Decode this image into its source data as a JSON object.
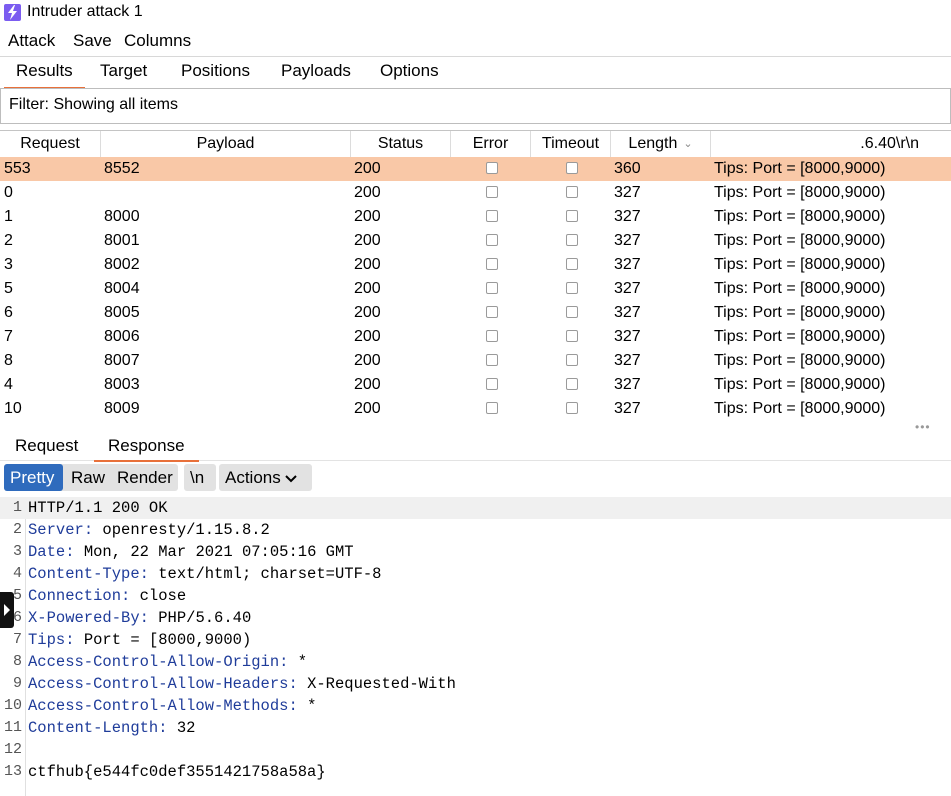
{
  "window": {
    "title": "Intruder attack 1"
  },
  "menu": [
    "Attack",
    "Save",
    "Columns"
  ],
  "top_tabs": [
    {
      "label": "Results",
      "active": true
    },
    {
      "label": "Target",
      "active": false
    },
    {
      "label": "Positions",
      "active": false
    },
    {
      "label": "Payloads",
      "active": false
    },
    {
      "label": "Options",
      "active": false
    }
  ],
  "filter": {
    "text": "Filter: Showing all items"
  },
  "table": {
    "headers": [
      "Request",
      "Payload",
      "Status",
      "Error",
      "Timeout",
      "Length",
      ".6.40\\r\\n"
    ],
    "rows": [
      {
        "request": "553",
        "payload": "8552",
        "status": "200",
        "length": "360",
        "extract": "Tips: Port = [8000,9000)",
        "selected": true
      },
      {
        "request": "0",
        "payload": "",
        "status": "200",
        "length": "327",
        "extract": "Tips: Port = [8000,9000)"
      },
      {
        "request": "1",
        "payload": "8000",
        "status": "200",
        "length": "327",
        "extract": "Tips: Port = [8000,9000)"
      },
      {
        "request": "2",
        "payload": "8001",
        "status": "200",
        "length": "327",
        "extract": "Tips: Port = [8000,9000)"
      },
      {
        "request": "3",
        "payload": "8002",
        "status": "200",
        "length": "327",
        "extract": "Tips: Port = [8000,9000)"
      },
      {
        "request": "5",
        "payload": "8004",
        "status": "200",
        "length": "327",
        "extract": "Tips: Port = [8000,9000)"
      },
      {
        "request": "6",
        "payload": "8005",
        "status": "200",
        "length": "327",
        "extract": "Tips: Port = [8000,9000)"
      },
      {
        "request": "7",
        "payload": "8006",
        "status": "200",
        "length": "327",
        "extract": "Tips: Port = [8000,9000)"
      },
      {
        "request": "8",
        "payload": "8007",
        "status": "200",
        "length": "327",
        "extract": "Tips: Port = [8000,9000)"
      },
      {
        "request": "4",
        "payload": "8003",
        "status": "200",
        "length": "327",
        "extract": "Tips: Port = [8000,9000)"
      },
      {
        "request": "10",
        "payload": "8009",
        "status": "200",
        "length": "327",
        "extract": "Tips: Port = [8000,9000)"
      }
    ]
  },
  "bottom_tabs": [
    {
      "label": "Request",
      "active": false
    },
    {
      "label": "Response",
      "active": true
    }
  ],
  "toolbar": {
    "pretty": "Pretty",
    "raw": "Raw",
    "render": "Render",
    "newline": "\\n",
    "actions": "Actions"
  },
  "response_lines": [
    {
      "key": "HTTP/1.1 200 OK",
      "value": ""
    },
    {
      "key": "Server",
      "value": "openresty/1.15.8.2"
    },
    {
      "key": "Date",
      "value": "Mon, 22 Mar 2021 07:05:16 GMT"
    },
    {
      "key": "Content-Type",
      "value": "text/html; charset=UTF-8"
    },
    {
      "key": "Connection",
      "value": "close"
    },
    {
      "key": "X-Powered-By",
      "value": "PHP/5.6.40"
    },
    {
      "key": "Tips",
      "value": "Port = [8000,9000)"
    },
    {
      "key": "Access-Control-Allow-Origin",
      "value": "*"
    },
    {
      "key": "Access-Control-Allow-Headers",
      "value": "X-Requested-With"
    },
    {
      "key": "Access-Control-Allow-Methods",
      "value": "*"
    },
    {
      "key": "Content-Length",
      "value": "32"
    },
    {
      "key": "",
      "value": ""
    },
    {
      "key": "ctfhub{e544fc0def3551421758a58a}",
      "value": ""
    }
  ],
  "colors": {
    "accent": "#e8703a",
    "selected_row": "#f9c8a7",
    "active_button": "#2f6bbd",
    "header_key": "#1f3c9a"
  }
}
